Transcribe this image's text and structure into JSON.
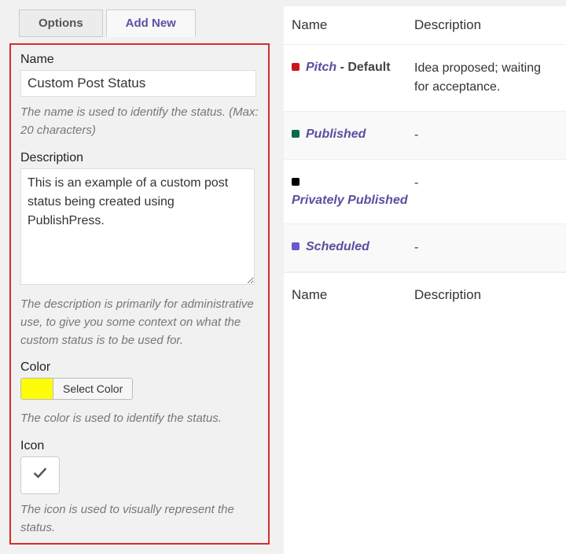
{
  "tabs": {
    "options": "Options",
    "add_new": "Add New"
  },
  "form": {
    "name_label": "Name",
    "name_value": "Custom Post Status",
    "name_help": "The name is used to identify the status. (Max: 20 characters)",
    "desc_label": "Description",
    "desc_value": "This is an example of a custom post status being created using PublishPress.",
    "desc_help": "The description is primarily for administrative use, to give you some context on what the custom status is to be used for.",
    "color_label": "Color",
    "color_value": "#fdfd09",
    "color_button": "Select Color",
    "color_help": "The color is used to identify the status.",
    "icon_label": "Icon",
    "icon_name": "check-icon",
    "icon_help": "The icon is used to visually represent the status."
  },
  "table": {
    "head_name": "Name",
    "head_desc": "Description",
    "rows": [
      {
        "color": "#c9161d",
        "name": "Pitch",
        "suffix": " - Default",
        "desc": "Idea proposed; waiting for acceptance."
      },
      {
        "color": "#0b6b49",
        "name": "Published",
        "suffix": "",
        "desc": "-"
      },
      {
        "color": "#000000",
        "name": "Privately Published",
        "suffix": "",
        "desc": "-"
      },
      {
        "color": "#6a5acd",
        "name": "Scheduled",
        "suffix": "",
        "desc": "-"
      }
    ]
  }
}
